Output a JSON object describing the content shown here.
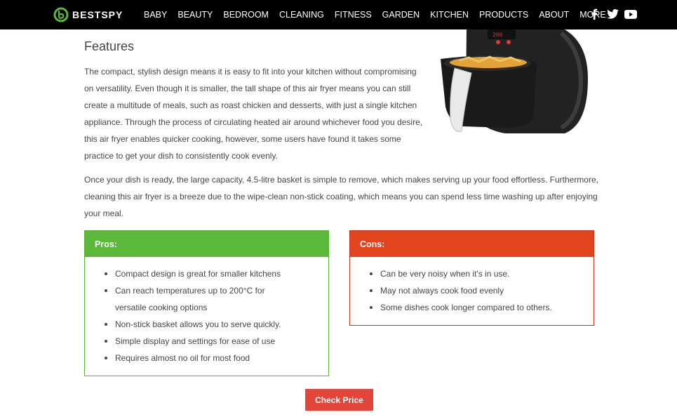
{
  "brand": {
    "name": "BESTSPY",
    "accent_color": "#5cb83a"
  },
  "nav": {
    "items": [
      "BABY",
      "BEAUTY",
      "BEDROOM",
      "CLEANING",
      "FITNESS",
      "GARDEN",
      "KITCHEN",
      "PRODUCTS",
      "ABOUT"
    ],
    "more_label": "MORE",
    "social": [
      "facebook-icon",
      "twitter-icon",
      "youtube-icon"
    ]
  },
  "content": {
    "heading": "Features",
    "paragraph1": "The compact, stylish design means it is easy to fit into your kitchen without compromising on versatility. Even though it is smaller, the tall shape of this air fryer means you can still create a multitude of meals, such as roast chicken and desserts, with just a single kitchen appliance. Through the process of circulating heated air around whichever food you desire, this air fryer enables quicker cooking, however, some users have found it takes some practice to get your dish to consistently cook evenly.",
    "paragraph2": "Once your dish is ready, the large capacity, 4.5-litre basket is simple to remove, which makes serving up your food effortless. Furthermore, cleaning this air fryer is a breeze due to the wipe-clean non-stick coating, which means you can spend less time washing up after enjoying your meal.",
    "image": "air-fryer-product-image"
  },
  "pros": {
    "title": "Pros:",
    "color": "#5cb83a",
    "items": [
      "Compact design is great for smaller kitchens",
      "Can reach temperatures up to 200°C for versatile cooking options",
      "Non-stick basket allows you to serve quickly.",
      "Simple display and settings for ease of use",
      "Requires almost no oil for most food"
    ]
  },
  "cons": {
    "title": "Cons:",
    "color": "#e2451e",
    "items": [
      "Can be very noisy when it's in use.",
      "May not always cook food evenly",
      "Some dishes cook longer compared to others."
    ]
  },
  "cta": {
    "label": "Check Price",
    "color": "#e2453a"
  }
}
